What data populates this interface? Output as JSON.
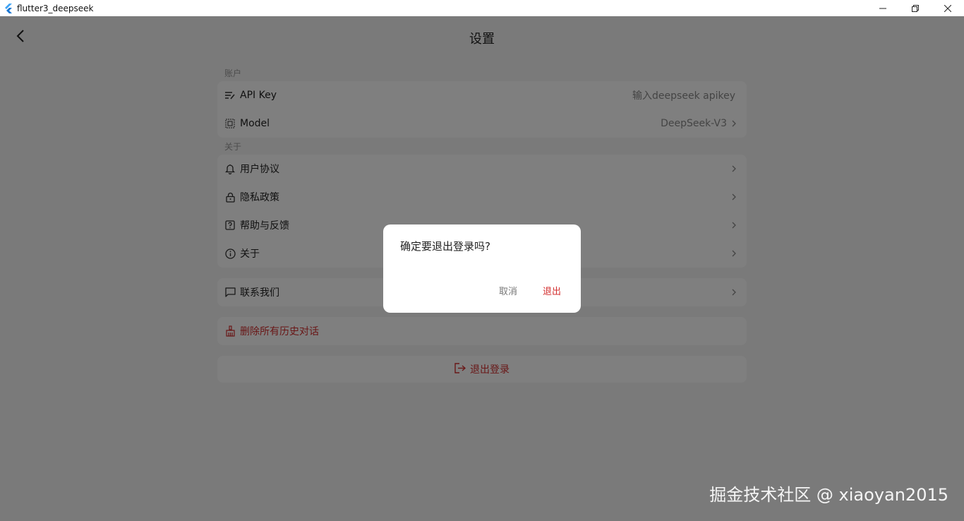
{
  "window": {
    "title": "flutter3_deepseek"
  },
  "header": {
    "title": "设置"
  },
  "sections": {
    "account": {
      "label": "账户",
      "items": [
        {
          "label": "API Key",
          "value": "输入deepseek apikey"
        },
        {
          "label": "Model",
          "value": "DeepSeek-V3"
        }
      ]
    },
    "about": {
      "label": "关于",
      "items": [
        {
          "label": "用户协议"
        },
        {
          "label": "隐私政策"
        },
        {
          "label": "帮助与反馈"
        },
        {
          "label": "关于"
        }
      ]
    }
  },
  "contact": {
    "label": "联系我们"
  },
  "delete_history": {
    "label": "删除所有历史对话"
  },
  "logout": {
    "label": "退出登录"
  },
  "dialog": {
    "message": "确定要退出登录吗?",
    "cancel": "取消",
    "confirm": "退出"
  },
  "watermark": "掘金技术社区 @ xiaoyan2015",
  "colors": {
    "danger": "#d32f2f",
    "overlay": "rgba(0,0,0,0.5)"
  },
  "icons": [
    "back-icon",
    "api-key-icon",
    "model-icon",
    "bell-icon",
    "lock-icon",
    "help-icon",
    "info-icon",
    "chat-icon",
    "broom-icon",
    "logout-icon",
    "chevron-right-icon"
  ]
}
